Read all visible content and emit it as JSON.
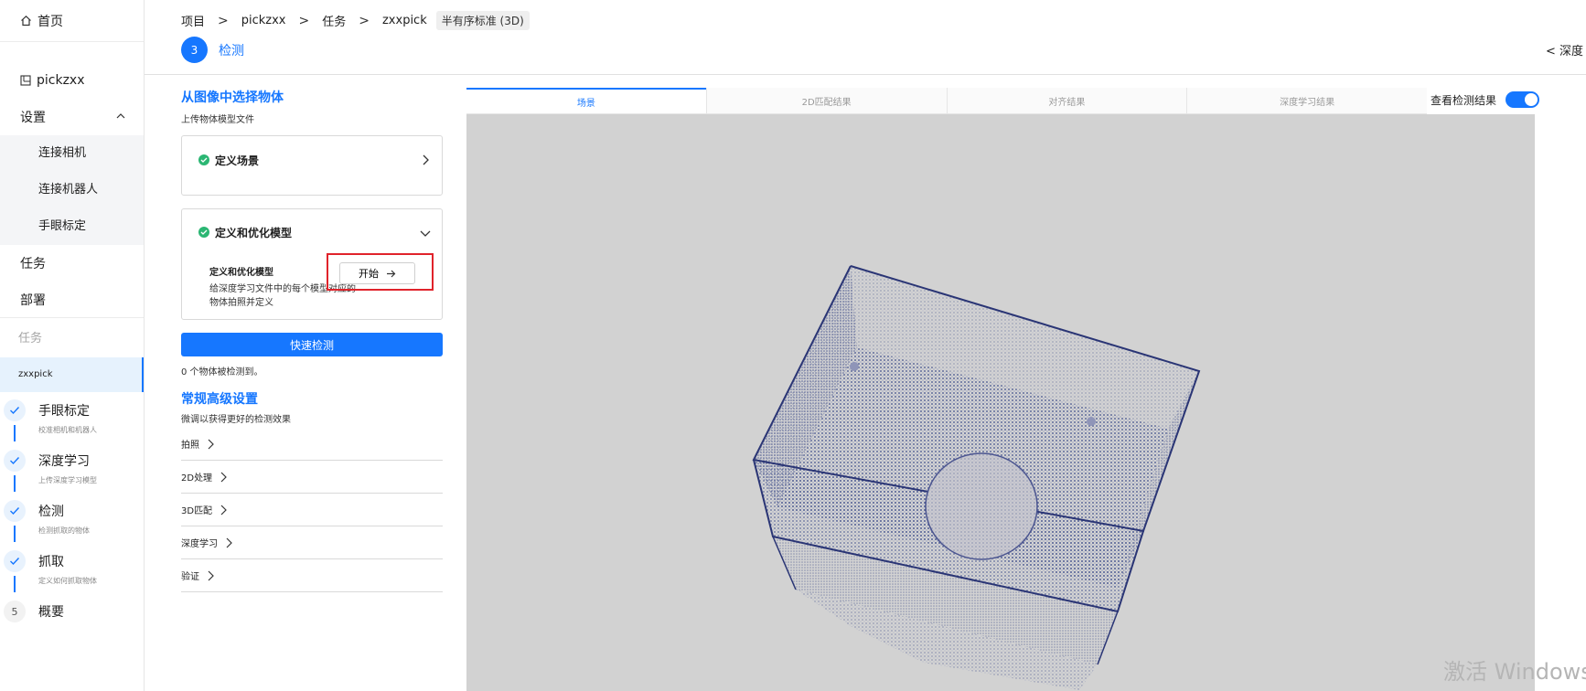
{
  "sidebar": {
    "home": "首页",
    "project": "pickzxx",
    "settings": "设置",
    "settings_items": [
      "连接相机",
      "连接机器人",
      "手眼标定"
    ],
    "task": "任务",
    "deploy": "部署",
    "task_section": "任务",
    "active_task": "zxxpick",
    "steps": [
      {
        "title": "手眼标定",
        "desc": "校准相机和机器人",
        "state": "done"
      },
      {
        "title": "深度学习",
        "desc": "上传深度学习模型",
        "state": "done"
      },
      {
        "title": "检测",
        "desc": "检测抓取的物体",
        "state": "done"
      },
      {
        "title": "抓取",
        "desc": "定义如何抓取物体",
        "state": "done"
      },
      {
        "title": "概要",
        "number": "5",
        "state": "todo"
      }
    ]
  },
  "breadcrumb": {
    "items": [
      "项目",
      "pickzxx",
      "任务",
      "zxxpick"
    ],
    "tag": "半有序标准 (3D)"
  },
  "step_header": {
    "number": "3",
    "label": "检测"
  },
  "depth_link": "深度",
  "panel": {
    "title": "从图像中选择物体",
    "subtitle": "上传物体模型文件",
    "card_scene": {
      "title": "定义场景"
    },
    "card_model": {
      "title": "定义和优化模型",
      "sub_title": "定义和优化模型",
      "desc": "给深度学习文件中的每个模型对应的物体拍照并定义",
      "start_label": "开始"
    },
    "quick_detect": "快速检测",
    "detect_count": "0 个物体被检测到。",
    "advanced_title": "常规高级设置",
    "advanced_subtitle": "微调以获得更好的检测效果",
    "advanced_items": [
      "拍照",
      "2D处理",
      "3D匹配",
      "深度学习",
      "验证"
    ]
  },
  "viewer": {
    "tabs": [
      "场景",
      "2D匹配结果",
      "对齐结果",
      "深度学习结果"
    ],
    "active_tab": 0,
    "toggle_label": "查看检测结果",
    "toggle_on": true
  },
  "watermark": "激活 Windows",
  "colors": {
    "accent": "#1677ff",
    "success": "#2bb673",
    "highlight": "#e0232b",
    "viewer_bg": "#d2d2d2"
  }
}
